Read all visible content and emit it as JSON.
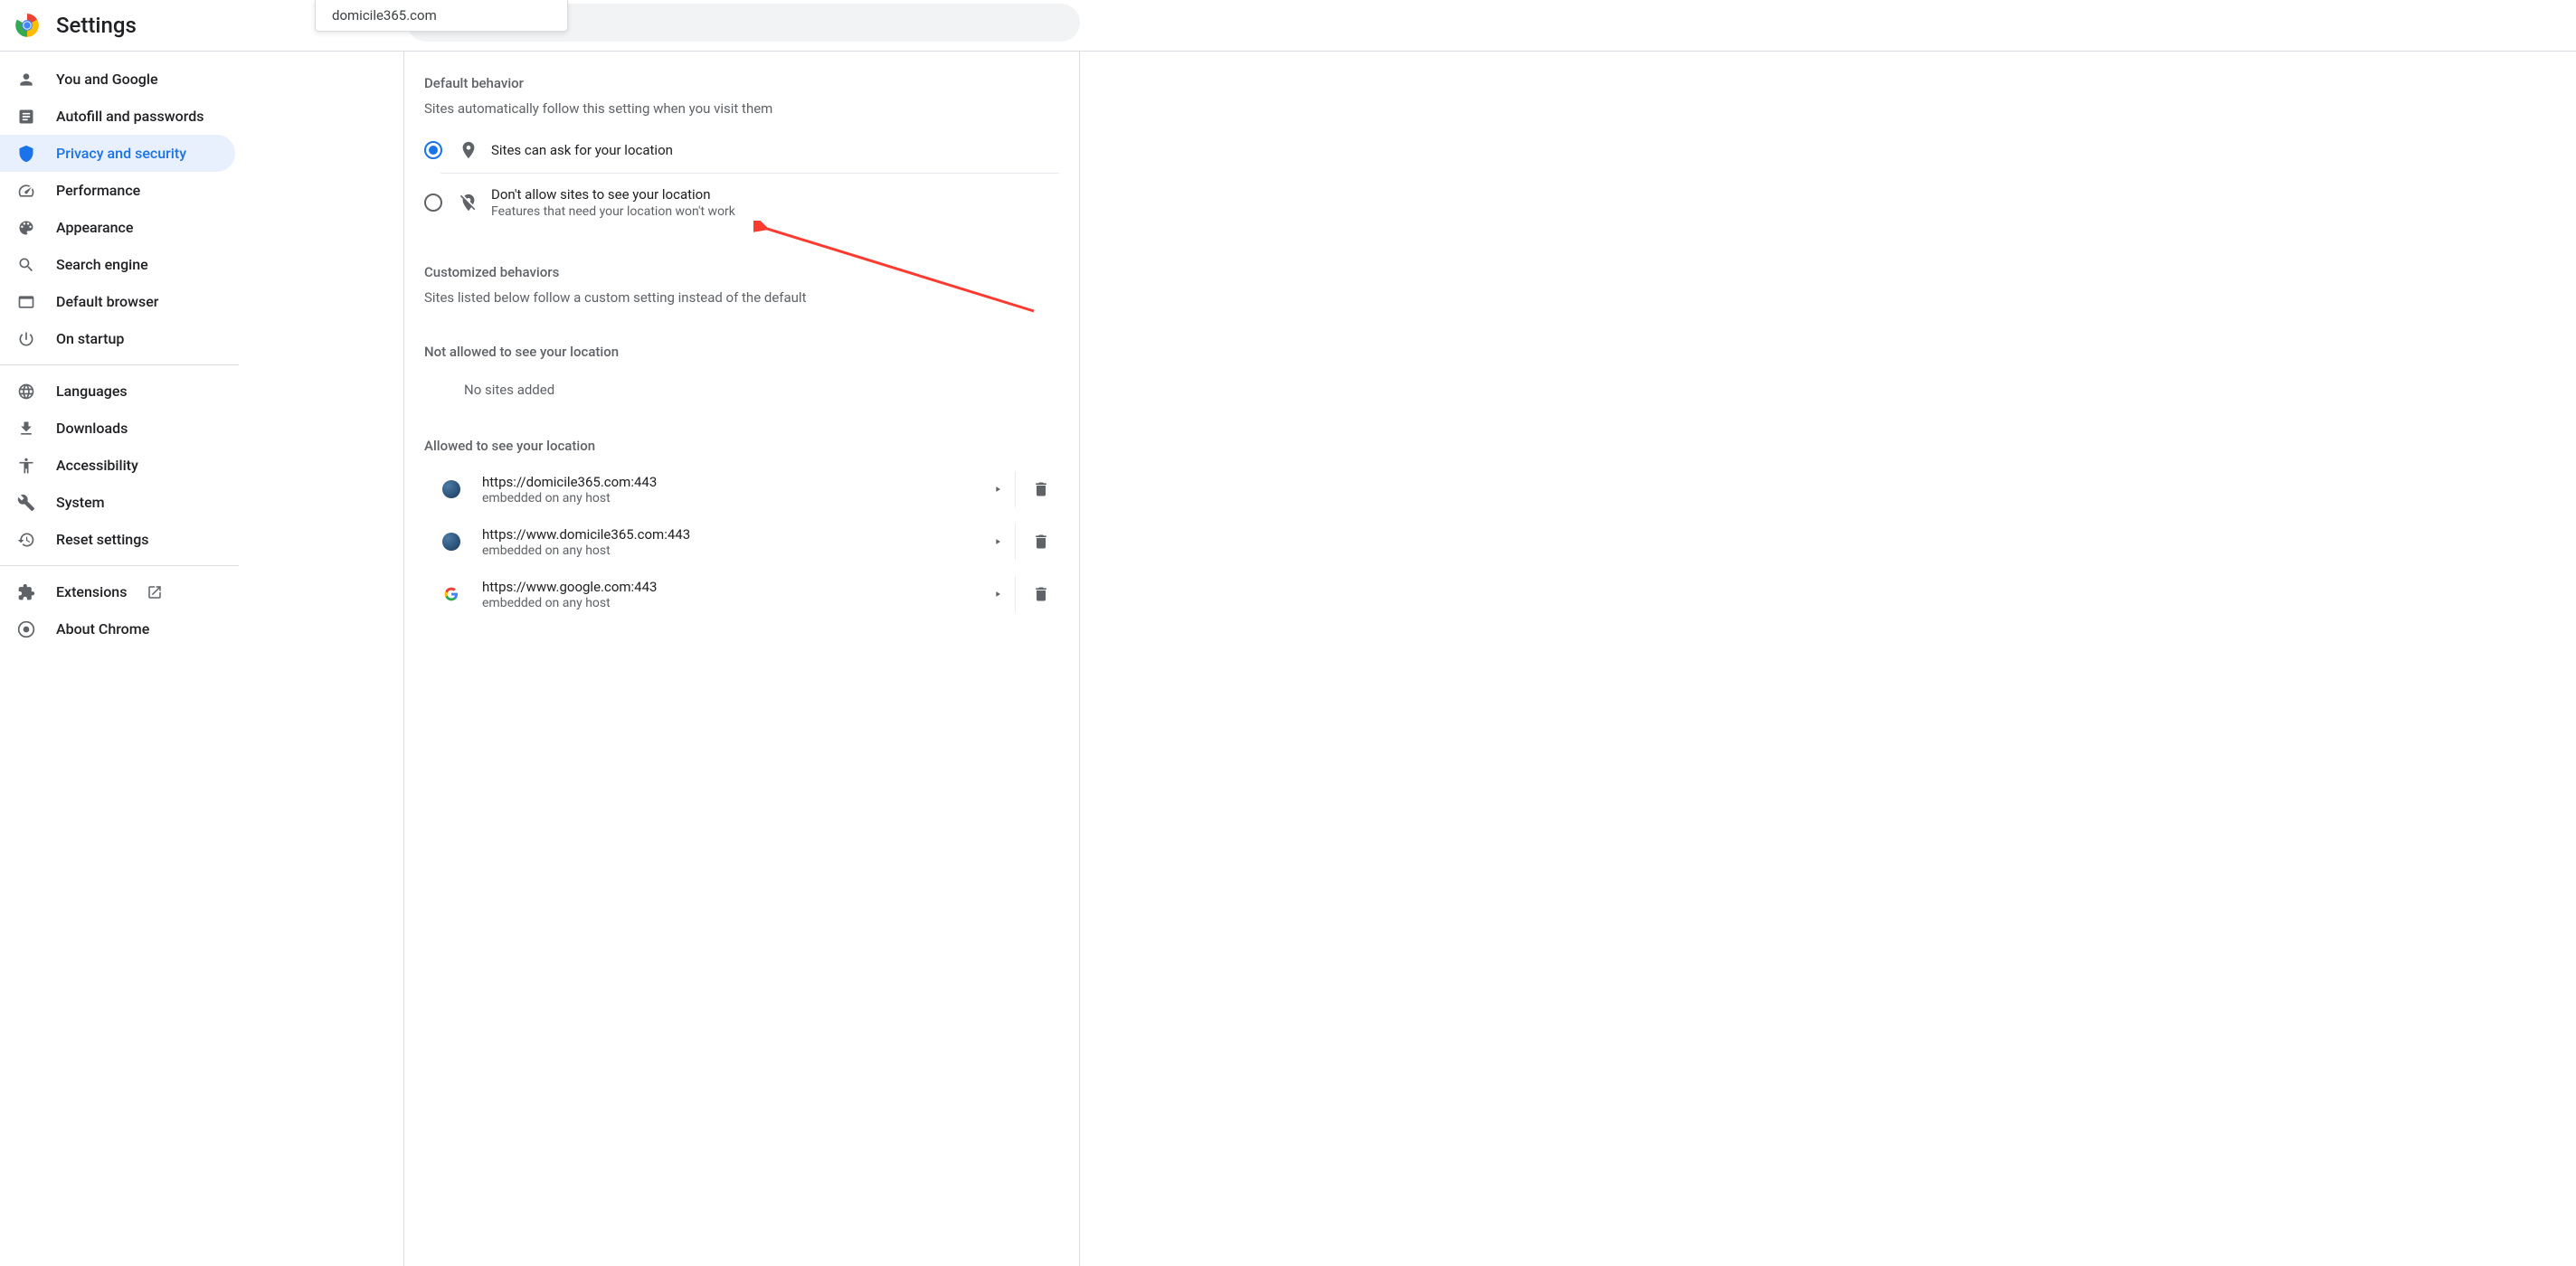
{
  "header": {
    "title": "Settings",
    "tooltip": "domicile365.com"
  },
  "sidebar": {
    "items": [
      {
        "label": "You and Google",
        "icon": "person"
      },
      {
        "label": "Autofill and passwords",
        "icon": "autofill"
      },
      {
        "label": "Privacy and security",
        "icon": "shield",
        "active": true
      },
      {
        "label": "Performance",
        "icon": "speed"
      },
      {
        "label": "Appearance",
        "icon": "palette"
      },
      {
        "label": "Search engine",
        "icon": "search"
      },
      {
        "label": "Default browser",
        "icon": "browser"
      },
      {
        "label": "On startup",
        "icon": "power"
      }
    ],
    "items2": [
      {
        "label": "Languages",
        "icon": "globe"
      },
      {
        "label": "Downloads",
        "icon": "download"
      },
      {
        "label": "Accessibility",
        "icon": "accessibility"
      },
      {
        "label": "System",
        "icon": "wrench"
      },
      {
        "label": "Reset settings",
        "icon": "reset"
      }
    ],
    "items3": [
      {
        "label": "Extensions",
        "icon": "extension",
        "external": true
      },
      {
        "label": "About Chrome",
        "icon": "chrome"
      }
    ]
  },
  "main": {
    "default_behavior": {
      "heading": "Default behavior",
      "subtext": "Sites automatically follow this setting when you visit them",
      "option1": {
        "label": "Sites can ask for your location",
        "checked": true
      },
      "option2": {
        "label": "Don't allow sites to see your location",
        "sublabel": "Features that need your location won't work",
        "checked": false
      }
    },
    "customized": {
      "heading": "Customized behaviors",
      "subtext": "Sites listed below follow a custom setting instead of the default"
    },
    "not_allowed": {
      "heading": "Not allowed to see your location",
      "empty": "No sites added"
    },
    "allowed": {
      "heading": "Allowed to see your location",
      "sites": [
        {
          "url": "https://domicile365.com:443",
          "sub": "embedded on any host",
          "favicon": "globe"
        },
        {
          "url": "https://www.domicile365.com:443",
          "sub": "embedded on any host",
          "favicon": "globe"
        },
        {
          "url": "https://www.google.com:443",
          "sub": "embedded on any host",
          "favicon": "google"
        }
      ]
    }
  }
}
